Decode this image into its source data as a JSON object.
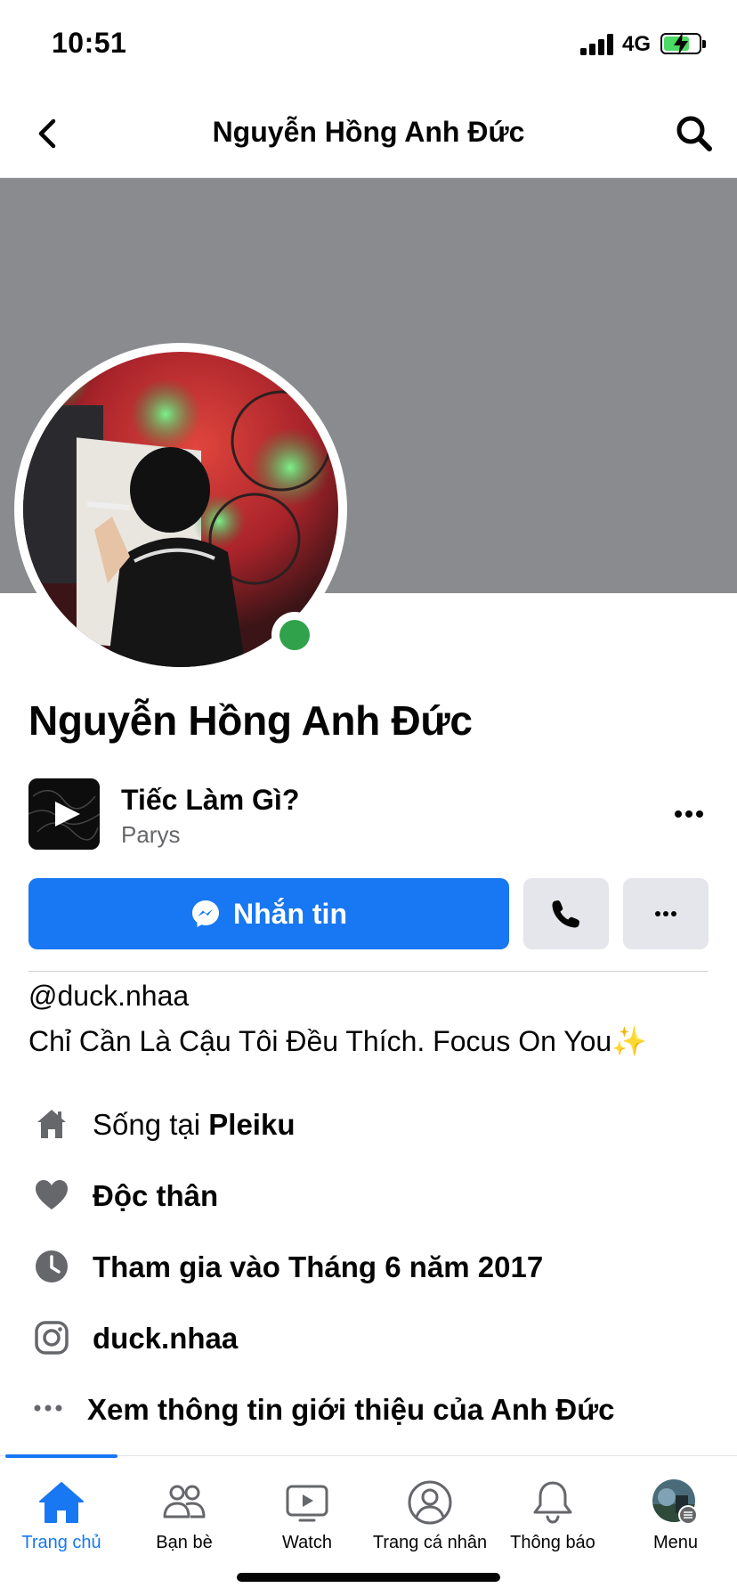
{
  "status_bar": {
    "time": "10:51",
    "network": "4G",
    "battery_level": 0.75
  },
  "header": {
    "title": "Nguyễn Hồng Anh Đức"
  },
  "profile": {
    "name": "Nguyễn Hồng Anh Đức",
    "online": true
  },
  "music": {
    "title": "Tiếc Làm Gì?",
    "artist": "Parys"
  },
  "actions": {
    "message_label": "Nhắn tin"
  },
  "bio": {
    "username": "@duck.nhaa",
    "text": "Chỉ Cần Là Cậu Tôi Đều Thích. Focus On You",
    "emoji": "✨"
  },
  "info": {
    "lives_prefix": "Sống tại ",
    "lives_city": "Pleiku",
    "relationship": "Độc thân",
    "joined": "Tham gia vào Tháng 6 năm 2017",
    "instagram": "duck.nhaa",
    "see_about": "Xem thông tin giới thiệu của Anh Đức"
  },
  "tabbar": {
    "items": [
      {
        "label": "Trang chủ",
        "icon": "home-icon",
        "active": true
      },
      {
        "label": "Bạn bè",
        "icon": "friends-icon",
        "active": false
      },
      {
        "label": "Watch",
        "icon": "watch-icon",
        "active": false
      },
      {
        "label": "Trang cá nhân",
        "icon": "profile-icon",
        "active": false
      },
      {
        "label": "Thông báo",
        "icon": "bell-icon",
        "active": false
      },
      {
        "label": "Menu",
        "icon": "menu-avatar-icon",
        "active": false
      }
    ]
  },
  "colors": {
    "accent": "#1877f2",
    "online": "#31a24c",
    "cover": "#898b8f",
    "secondary_text": "#65676b"
  }
}
